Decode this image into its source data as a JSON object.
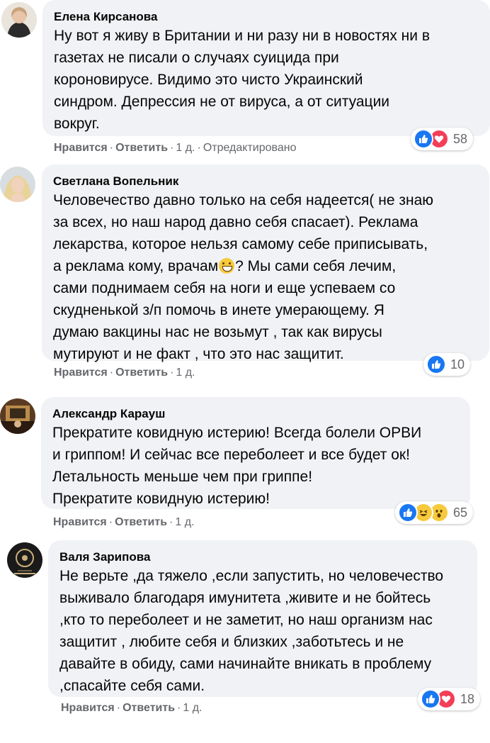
{
  "actions": {
    "like": "Нравится",
    "reply": "Ответить",
    "sep": "·"
  },
  "comments": [
    {
      "author": "Елена Кирсанова",
      "lines": [
        "Ну вот я живу в Британии и ни разу ни в новостях ни в",
        "газетах не писали о случаях суицида при",
        "короновирусе. Видимо это чисто Украинский",
        "синдром. Депрессия не от вируса, а от ситуации",
        "вокруг."
      ],
      "time": "1 д.",
      "edited": "Отредактировано",
      "reactions": [
        "like",
        "love"
      ],
      "count": "58"
    },
    {
      "author": "Светлана Вопельник",
      "lines": [
        "Человечество давно только на себя надеется( не знаю",
        "за всех, но наш народ давно себя спасает). Реклама",
        "лекарства, которое нельзя самому себе приписывать,",
        "а реклама кому, врачам",
        "? Мы сами себя лечим,",
        "сами поднимаем себя на ноги и еще успеваем со",
        "скудненькой з/п помочь в инете умерающему. Я",
        "думаю вакцины нас не возьмут , так как вирусы",
        "мутируют и не факт , что это нас защитит."
      ],
      "time": "1 д.",
      "reactions": [
        "like"
      ],
      "count": "10"
    },
    {
      "author": "Александр Карауш",
      "lines": [
        "Прекратите ковидную истерию! Всегда болели ОРВИ",
        "и гриппом! И сейчас все переболеет и все будет ок!",
        "Летальность меньше чем при гриппе!",
        "Прекратите ковидную истерию!"
      ],
      "time": "1 д.",
      "reactions": [
        "like",
        "haha",
        "wow"
      ],
      "count": "65"
    },
    {
      "author": "Валя Зарипова",
      "lines": [
        "Не верьте ,да тяжело ,если запустить, но человечество",
        "выживало благодаря имунитета ,живите и не бойтесь",
        ",кто то переболеет и не заметит, но наш организм нас",
        "защитит , любите себя и близких ,заботьтесь и не",
        "давайте в обиду, сами начинайте вникать в проблему",
        ",спасайте себя сами."
      ],
      "time": "1 д.",
      "reactions": [
        "like",
        "love"
      ],
      "count": "18"
    }
  ]
}
